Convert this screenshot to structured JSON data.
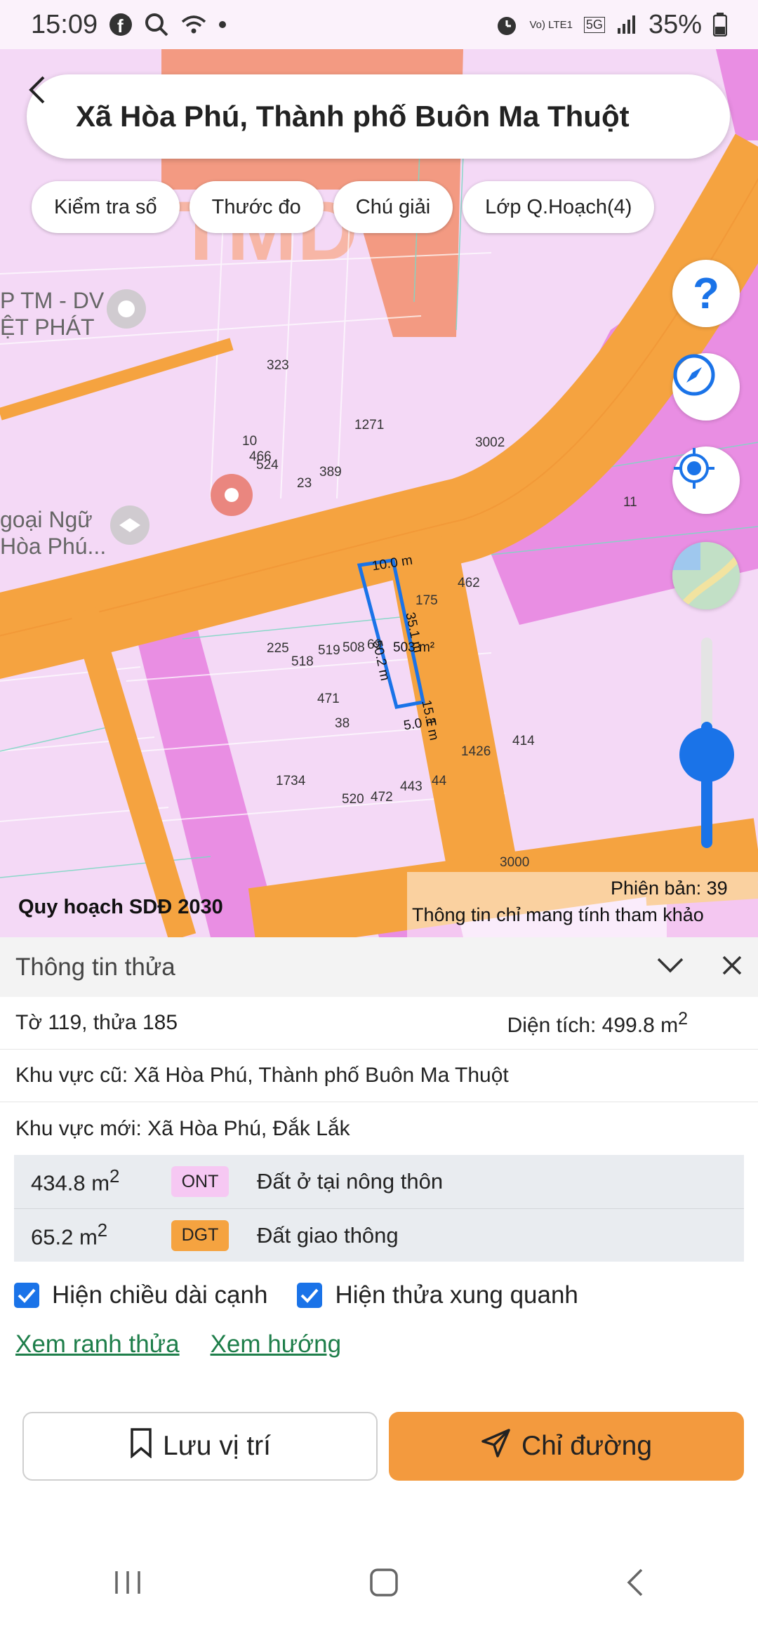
{
  "status_bar": {
    "time": "15:09",
    "network_label": "Vo) LTE1",
    "network_type": "5G",
    "battery": "35%"
  },
  "search": {
    "title": "Xã Hòa Phú, Thành phố Buôn Ma Thuột"
  },
  "chips": [
    "Kiểm tra sổ",
    "Thước đo",
    "Chú giải",
    "Lớp Q.Hoạch(4)"
  ],
  "map": {
    "legend_left": "Quy hoạch SDĐ 2030",
    "version": "Phiên bản: 39",
    "disclaimer": "Thông tin chỉ mang tính tham khảo",
    "poi_labels": [
      "P TM - DV",
      "ỆT PHÁT",
      "goại Ngữ",
      "Hòa Phú..."
    ],
    "bg_text": "TMD",
    "parcel_numbers": [
      "323",
      "1271",
      "3002",
      "10",
      "466",
      "524",
      "389",
      "23",
      "11",
      "462",
      "175",
      "225",
      "518",
      "519",
      "508",
      "69",
      "471",
      "38",
      "1426",
      "414",
      "1734",
      "520",
      "472",
      "443",
      "44",
      "3000"
    ],
    "measurements": {
      "top": "10.0 m",
      "right_upper": "35.1 m",
      "left": "50.2 m",
      "right_lower": "15.1 m",
      "bottom": "5.0 m",
      "area": "503 m²"
    }
  },
  "panel": {
    "title": "Thông tin thửa",
    "sheet": "Tờ 119, thửa 185",
    "area_label": "Diện tích: 499.8 m",
    "area_sup": "2",
    "old_region": "Khu vực cũ: Xã Hòa Phú, Thành phố Buôn Ma Thuột",
    "new_region": "Khu vực mới: Xã Hòa Phú, Đắk Lắk",
    "land_uses": [
      {
        "area": "434.8 m",
        "sup": "2",
        "code": "ONT",
        "name": "Đất ở tại nông thôn",
        "color": "#f6c8f3"
      },
      {
        "area": "65.2 m",
        "sup": "2",
        "code": "DGT",
        "name": "Đất giao thông",
        "color": "#f5a340"
      }
    ],
    "checks": [
      "Hiện chiều dài cạnh",
      "Hiện thửa xung quanh"
    ],
    "links": [
      "Xem ranh thửa",
      "Xem hướng"
    ],
    "buttons": {
      "save": "Lưu vị trí",
      "directions": "Chỉ đường"
    }
  },
  "colors": {
    "accent": "#1a73e8",
    "orange": "#f39a3e",
    "link": "#1e7e4a",
    "road": "#f5a340",
    "residential": "#f4d9f6"
  }
}
